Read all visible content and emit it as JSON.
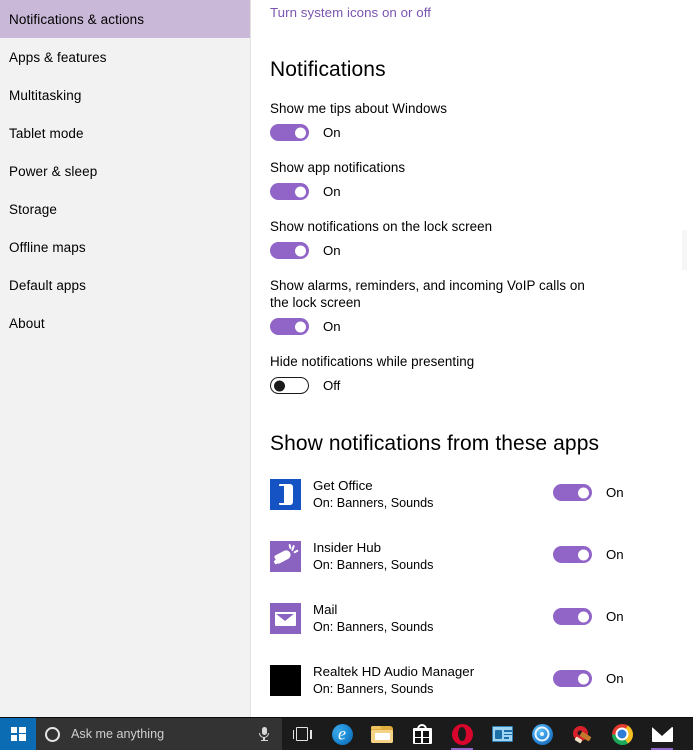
{
  "sidebar": {
    "items": [
      {
        "label": "Notifications & actions",
        "selected": true
      },
      {
        "label": "Apps & features",
        "selected": false
      },
      {
        "label": "Multitasking",
        "selected": false
      },
      {
        "label": "Tablet mode",
        "selected": false
      },
      {
        "label": "Power & sleep",
        "selected": false
      },
      {
        "label": "Storage",
        "selected": false
      },
      {
        "label": "Offline maps",
        "selected": false
      },
      {
        "label": "Default apps",
        "selected": false
      },
      {
        "label": "About",
        "selected": false
      }
    ]
  },
  "content": {
    "system_icons_link": "Turn system icons on or off",
    "notifications_heading": "Notifications",
    "settings": [
      {
        "label": "Show me tips about Windows",
        "state": "On",
        "on": true
      },
      {
        "label": "Show app notifications",
        "state": "On",
        "on": true
      },
      {
        "label": "Show notifications on the lock screen",
        "state": "On",
        "on": true
      },
      {
        "label": "Show alarms, reminders, and incoming VoIP calls on the lock screen",
        "state": "On",
        "on": true
      },
      {
        "label": "Hide notifications while presenting",
        "state": "Off",
        "on": false
      }
    ],
    "apps_heading": "Show notifications from these apps",
    "apps": [
      {
        "name": "Get Office",
        "detail": "On: Banners, Sounds",
        "state": "On",
        "on": true,
        "icon": "get-office-icon",
        "icon_color": "#1552c4"
      },
      {
        "name": "Insider Hub",
        "detail": "On: Banners, Sounds",
        "state": "On",
        "on": true,
        "icon": "insider-hub-icon",
        "icon_color": "#8a62c0"
      },
      {
        "name": "Mail",
        "detail": "On: Banners, Sounds",
        "state": "On",
        "on": true,
        "icon": "mail-icon",
        "icon_color": "#8a62c0"
      },
      {
        "name": "Realtek HD Audio Manager",
        "detail": "On: Banners, Sounds",
        "state": "On",
        "on": true,
        "icon": "realtek-icon",
        "icon_color": "#000000"
      }
    ]
  },
  "taskbar": {
    "start_label": "Start",
    "search_placeholder": "Ask me anything",
    "cortana_label": "Cortana",
    "mic_label": "Microphone",
    "taskview_label": "Task View",
    "apps": [
      {
        "name": "microsoft-edge",
        "running": false
      },
      {
        "name": "file-explorer",
        "running": false
      },
      {
        "name": "microsoft-store",
        "running": false
      },
      {
        "name": "opera-browser",
        "running": true
      },
      {
        "name": "contact-card-app",
        "running": false
      },
      {
        "name": "blue-circle-app",
        "running": false
      },
      {
        "name": "ccleaner",
        "running": false
      },
      {
        "name": "google-chrome",
        "running": false
      },
      {
        "name": "mail-app",
        "running": true
      }
    ]
  },
  "colors": {
    "accent_purple": "#9164c7",
    "link_purple": "#7a54b0",
    "sidebar_selected": "#c9b8d8",
    "sidebar_bg": "#f2f2f2",
    "taskbar_bg": "#1b1b1b",
    "start_blue": "#0b6cb3"
  }
}
